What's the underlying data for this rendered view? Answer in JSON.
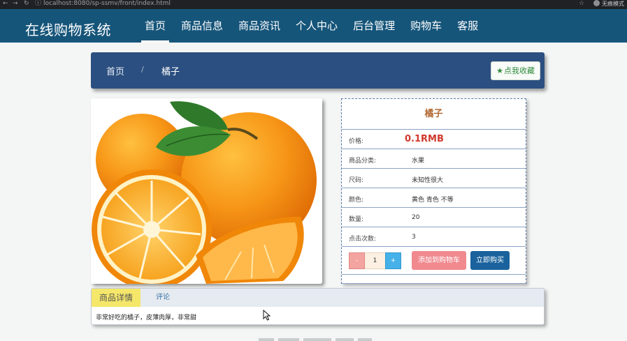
{
  "browser": {
    "url": "localhost:8080/sp-ssmv/front/index.html",
    "profile_label": "无痕模式"
  },
  "site": {
    "brand": "在线购物系统",
    "nav": [
      {
        "label": "首页",
        "active": true
      },
      {
        "label": "商品信息",
        "active": false
      },
      {
        "label": "商品资讯",
        "active": false
      },
      {
        "label": "个人中心",
        "active": false
      },
      {
        "label": "后台管理",
        "active": false
      },
      {
        "label": "购物车",
        "active": false
      },
      {
        "label": "客服",
        "active": false
      }
    ]
  },
  "breadcrumb": {
    "home": "首页",
    "separator": "/",
    "current": "橘子",
    "favorite_label": "点我收藏",
    "favorite_icon": "star-icon"
  },
  "product": {
    "name": "橘子",
    "image_alt": "oranges",
    "rows": [
      {
        "label": "价格:",
        "value": "0.1RMB",
        "kind": "price"
      },
      {
        "label": "商品分类:",
        "value": "水果"
      },
      {
        "label": "尺码:",
        "value": "未知性很大"
      },
      {
        "label": "颜色:",
        "value": "黄色 青色 不等"
      },
      {
        "label": "数量:",
        "value": "20"
      },
      {
        "label": "点击次数:",
        "value": "3"
      }
    ],
    "quantity": {
      "minus": "-",
      "value": "1",
      "plus": "+"
    },
    "add_to_cart_label": "添加到购物车",
    "buy_now_label": "立即购买"
  },
  "details": {
    "tabs": [
      {
        "label": "商品详情",
        "active": true
      },
      {
        "label": "评论",
        "active": false
      }
    ],
    "description": "非常好吃的橘子，皮薄肉厚，非常甜"
  },
  "colors": {
    "navbar": "#16557a",
    "breadcrumb_panel": "#2b4f80",
    "price": "#d0392c",
    "add_cart": "#f08a8f",
    "buy_now": "#19629d",
    "active_tab": "#f5e76a"
  }
}
